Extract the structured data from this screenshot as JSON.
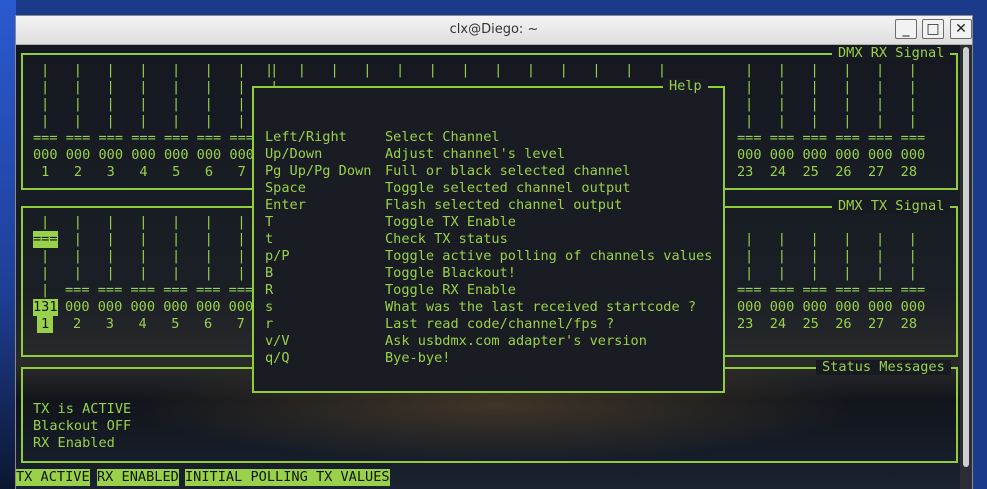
{
  "window": {
    "title": "clx@Diego: ~",
    "minimize_label": "_",
    "maximize_label": "□",
    "close_label": "✕"
  },
  "rx_panel": {
    "title": "DMX RX Signal",
    "left_bars": [
      "|   |   |   |   |   |   |   |",
      "|   |   |   |   |   |   |   |",
      "|   |   |   |   |   |   |   |",
      "|   |   |   |   |   |   |   |"
    ],
    "left_eq": "=== === === === === === ===",
    "left_values": "000 000 000 000 000 000 000",
    "left_channels": " 1   2   3   4   5   6   7",
    "top_bars": "|   |   |   |   |   |   |   |   |   |   |   |   |",
    "right_bars": [
      "|   |   |   |   |   |",
      "|   |   |   |   |   |",
      "|   |   |   |   |   |",
      "|   |   |   |   |   |"
    ],
    "right_eq": "=== === === === === ===",
    "right_values": "000 000 000 000 000 000",
    "right_channels": "23  24  25  26  27  28"
  },
  "tx_panel": {
    "title": "DMX TX Signal",
    "selected_eq": "===",
    "selected_value": "131",
    "selected_channel": "1",
    "left_bars": [
      "    |   |   |   |   |   |",
      "    |   |   |   |   |   |",
      "    |   |   |   |   |   |",
      "    |   |   |   |   |   |"
    ],
    "col1_bars": [
      "|",
      "",
      "|",
      "|",
      "|"
    ],
    "left_eq": "=== === === === === ===",
    "left_values": "000 000 000 000 000 000",
    "left_channels": "2   3   4   5   6   7",
    "right_bars": [
      "|   |   |   |   |   |",
      "|   |   |   |   |   |",
      "|   |   |   |   |   |",
      "|   |   |   |   |   |"
    ],
    "right_eq": "=== === === === === ===",
    "right_values": "000 000 000 000 000 000",
    "right_channels": "23  24  25  26  27  28"
  },
  "status_panel": {
    "title": "Status Messages",
    "lines": [
      "TX is ACTIVE",
      "Blackout OFF",
      "RX Enabled"
    ]
  },
  "help": {
    "title": "Help",
    "rows": [
      {
        "key": "Left/Right",
        "desc": "Select Channel"
      },
      {
        "key": "Up/Down",
        "desc": "Adjust channel's level"
      },
      {
        "key": "Pg Up/Pg Down",
        "desc": "Full or black selected channel"
      },
      {
        "key": "Space",
        "desc": "Toggle selected channel output"
      },
      {
        "key": "Enter",
        "desc": "Flash selected channel output"
      },
      {
        "key": "T",
        "desc": "Toggle TX Enable"
      },
      {
        "key": "t",
        "desc": "Check TX status"
      },
      {
        "key": "p/P",
        "desc": "Toggle active polling of channels values"
      },
      {
        "key": "B",
        "desc": "Toggle Blackout!"
      },
      {
        "key": "R",
        "desc": "Toggle RX Enable"
      },
      {
        "key": "s",
        "desc": "What was the last received startcode ?"
      },
      {
        "key": "r",
        "desc": "Last read code/channel/fps ?"
      },
      {
        "key": "v/V",
        "desc": "Ask usbdmx.com adapter's version"
      },
      {
        "key": "q/Q",
        "desc": "Bye-bye!"
      }
    ]
  },
  "status_bar": {
    "items": [
      "TX ACTIVE",
      "RX ENABLED",
      "INITIAL POLLING TX VALUES"
    ]
  },
  "colors": {
    "terminal_green": "#9ad14b",
    "frame_green": "#8fce3a",
    "terminal_bg": "#1a1d22"
  }
}
